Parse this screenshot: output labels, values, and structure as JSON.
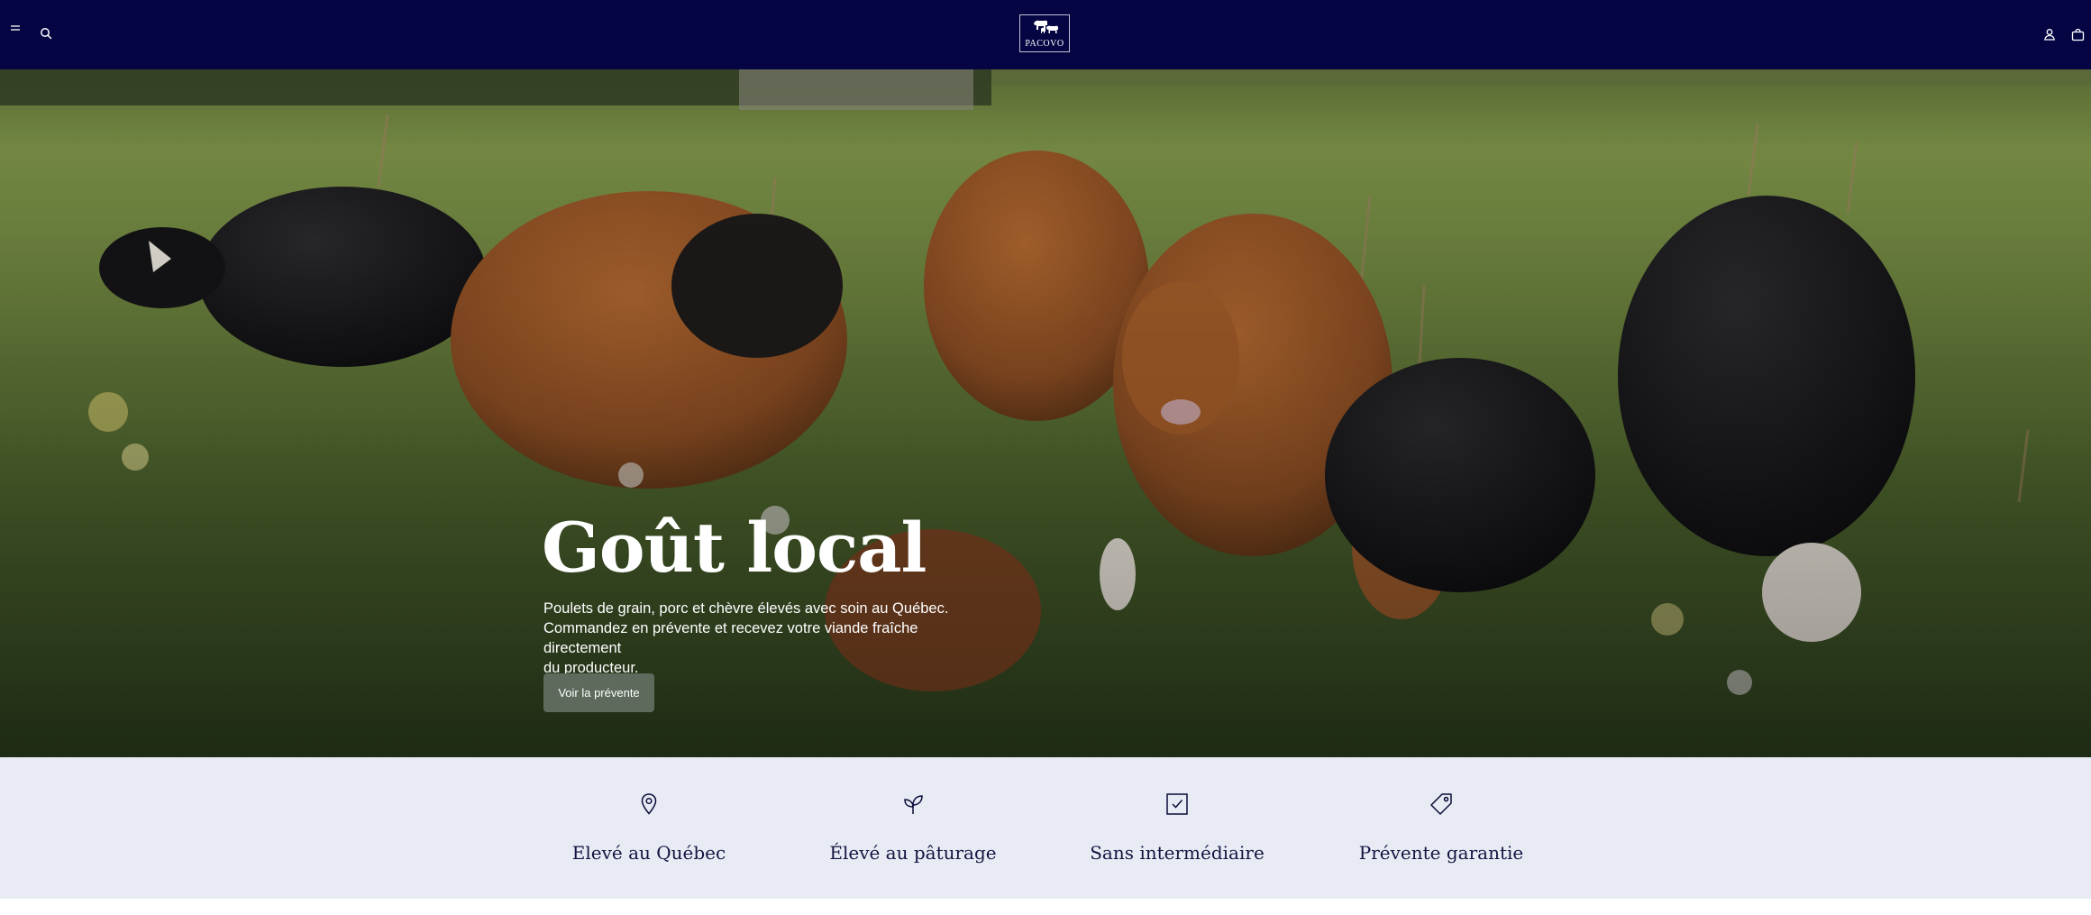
{
  "header": {
    "logo_text": "PACOVO",
    "menu_icon": "menu-icon",
    "search_icon": "search-icon",
    "account_icon": "user-icon",
    "cart_icon": "shopping-bag-icon",
    "background_color": "#050544"
  },
  "hero": {
    "title": "Goût local",
    "description_lines": [
      "Poulets de grain, porc et chèvre élevés avec soin au Québec.",
      "Commandez en prévente et recevez votre viande fraîche directement",
      "du producteur."
    ],
    "cta_label": "Voir la prévente",
    "cta_color": "#5d6a5c"
  },
  "features": {
    "background_color": "#e8ebf4",
    "items": [
      {
        "icon": "map-pin-icon",
        "label": "Elevé au Québec"
      },
      {
        "icon": "sprout-icon",
        "label": "Élevé au pâturage"
      },
      {
        "icon": "checkbox-icon",
        "label": "Sans intermédiaire"
      },
      {
        "icon": "tag-icon",
        "label": "Prévente garantie"
      }
    ]
  }
}
